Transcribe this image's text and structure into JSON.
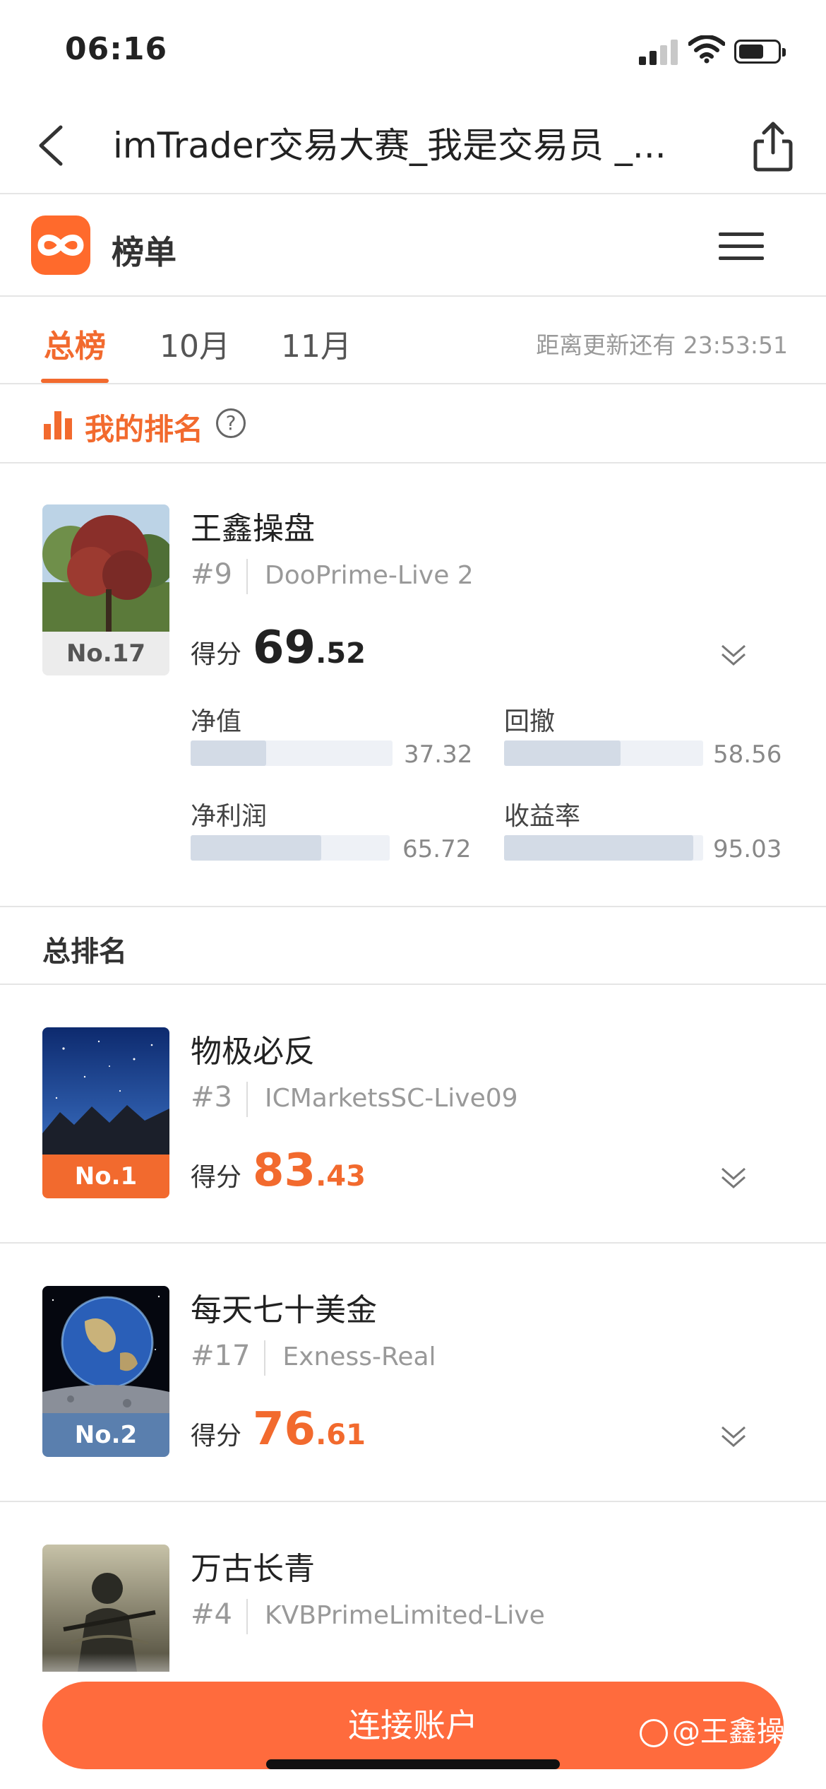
{
  "status_bar": {
    "time": "06:16"
  },
  "nav": {
    "title": "imTrader交易大赛_我是交易员 _..."
  },
  "app": {
    "name": "榜单"
  },
  "tabs": [
    {
      "label": "总榜",
      "active": true
    },
    {
      "label": "10月",
      "active": false
    },
    {
      "label": "11月",
      "active": false
    }
  ],
  "countdown": "距离更新还有 23:53:51",
  "my_rank": {
    "label": "我的排名",
    "help": "?",
    "card": {
      "position_tag": "No.17",
      "name": "王鑫操盘",
      "rank": "#9",
      "server": "DooPrime-Live 2",
      "score_label": "得分",
      "score_int": "69",
      "score_dec": ".52",
      "metrics": [
        {
          "label": "净值",
          "value": "37.32",
          "level": 0.3732
        },
        {
          "label": "回撤",
          "value": "58.56",
          "level": 0.5856
        },
        {
          "label": "净利润",
          "value": "65.72",
          "level": 0.6572
        },
        {
          "label": "收益率",
          "value": "95.03",
          "level": 0.9503
        }
      ]
    }
  },
  "overall": {
    "title": "总排名",
    "entries": [
      {
        "tag": "No.1",
        "name": "物极必反",
        "rank": "#3",
        "server": "ICMarketsSC-Live09",
        "score_label": "得分",
        "score_int": "83",
        "score_dec": ".43"
      },
      {
        "tag": "No.2",
        "name": "每天七十美金",
        "rank": "#17",
        "server": "Exness-Real",
        "score_label": "得分",
        "score_int": "76",
        "score_dec": ".61"
      },
      {
        "tag": "",
        "name": "万古长青",
        "rank": "#4",
        "server": "KVBPrimeLimited-Live"
      }
    ]
  },
  "cta": {
    "label": "连接账户"
  },
  "watermark": "@王鑫操盘",
  "colors": {
    "accent": "#f26a2e",
    "cta": "#ff6b3d",
    "no2_tag": "#5a7fae"
  }
}
